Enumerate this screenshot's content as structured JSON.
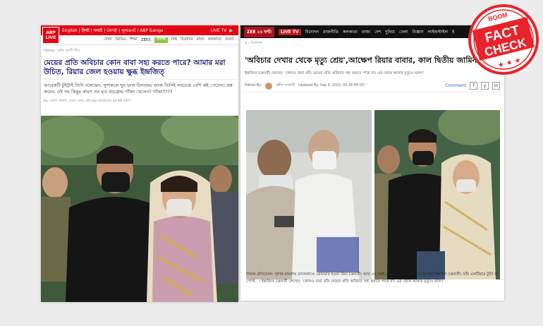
{
  "left": {
    "logo_line1": "ABP",
    "logo_line2": "LIVE",
    "topbar_links": "English | हिन्दी | मराठी | ਪੰਜਾਬੀ | ગુજરાતી | ABP Ganga",
    "live_tv": "LIVE TV",
    "nav": [
      "খেলা",
      "ভিডিও",
      "শিক্ষা",
      "ZEE5",
      "দেশ",
      "বিশ্ব",
      "বিনোদন",
      "রাজ্য",
      "কলকাতা",
      "ব্যবসা"
    ],
    "nav_badge": "বিশেষ",
    "breadcrumb": "Home  ›  হালি কর্মসী টিপ",
    "headline": "মেয়ের প্রতি অবিচার কোন বাবা সহ্য করতে পারে? আমার মরা উচিত, রিয়ার জেল হওয়ায় ক্ষুব্ধ ইন্দ্রজিত্",
    "summary": "আরেকটি টুইট্টাই তিনি বলেছেন, সুশান্তকে খুব ভাল চিনতাম। আজ তিনিই সবচেয়ে বেশি কষ্ট পেতেন। প্রশ্ন করেন, ওই সব কিছুর কারণ ওর মৃত বয়ফ্রেন্ড গাঁজা খেতেন? গাঁজা????",
    "byline": "By: এবিপি আনন্দ, ওয়েব ডেস্ক   |   09 Sep 2020 01:38 PM (IST)"
  },
  "right": {
    "logo": "ZEE ২৪ ঘণ্টা",
    "live_tv": "LIVE TV",
    "nav": [
      "বিনোদন",
      "রাজনীতি",
      "কলকাতা",
      "রাজ্য",
      "দেশ",
      "দুনিয়া",
      "খেলা",
      "বিজ্ঞান",
      "লাইফস্টাইল",
      "ই"
    ],
    "breadcrumb": "  ›  বিনোদন",
    "headline": "'অবিচার দেখার থেকে মৃত্যু শ্রেয়',আক্ষেপ রিয়ার বাবার, কাল দ্বিতীয় জামিন শুনানি",
    "intro": "ইন্দ্রজিত চক্রবর্তী লেখেন, 'কোনও বাবা তাঁর মেয়ের প্রতি অবিচার সহ্য করতে পারে না। এর থেকে আমার মৃত্যুও ভাল।'",
    "edited_by": "Edited By:",
    "author": "প্রদীপ দেখাজী",
    "updated": "Updated By: Sep 9, 2020, 04:28 PM IST",
    "comment": "Comment",
    "share_icons": [
      "f",
      "y",
      "in"
    ],
    "caption": "নিজস্ব প্রতিবেদন: সুশান্ত মামলায় মাদককাণ্ডে গ্রেফতার হওয়া রিয়া চক্রবর্তী। আর এর পরই একমাত্র তে পারেন মেয়ের বাবা ইন্দ্রজিৎ চক্রবর্তী। তাঁর একটিমাত্র টুইট বা পোস্ট...। ইন্দ্রজিত চক্রবর্তী লেখেন, 'কোনও বাবা তাঁর মেয়ের প্রতি অবিচার সহ্য করতে পারে না। এর থেকে আমার মৃত্যুও ভাল।'"
  },
  "stamp": {
    "boom": "BOOM",
    "fact": "FACT",
    "check": "CHECK",
    "color": "#e8232a"
  }
}
